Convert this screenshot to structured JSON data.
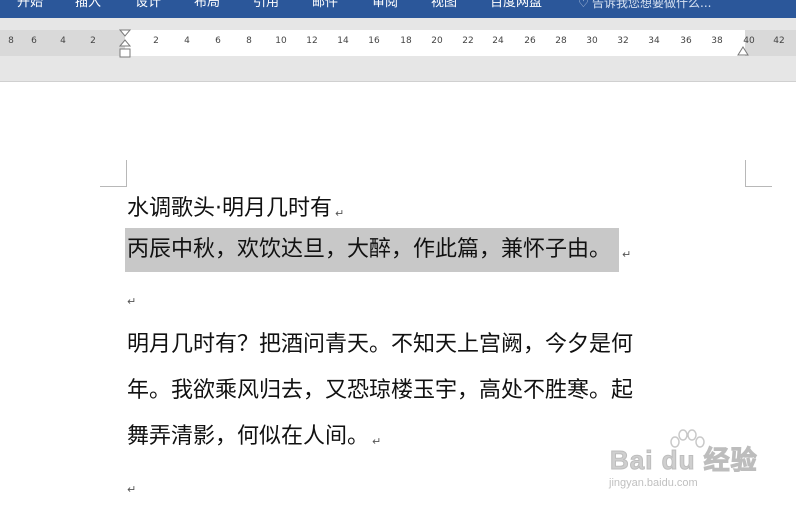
{
  "ribbon": {
    "tabs": [
      {
        "label": "开始"
      },
      {
        "label": "插入"
      },
      {
        "label": "设计"
      },
      {
        "label": "布局"
      },
      {
        "label": "引用"
      },
      {
        "label": "邮件"
      },
      {
        "label": "审阅"
      },
      {
        "label": "视图"
      },
      {
        "label": "百度网盘"
      }
    ],
    "tellme_text": "告诉我您想要做什么..."
  },
  "ruler": {
    "numbers": [
      "8",
      "6",
      "4",
      "2",
      "2",
      "4",
      "6",
      "8",
      "10",
      "12",
      "14",
      "16",
      "18",
      "20",
      "22",
      "24",
      "26",
      "28",
      "30",
      "32",
      "34",
      "36",
      "38",
      "40",
      "42"
    ]
  },
  "document": {
    "title": "水调歌头·明月几时有",
    "subtitle": "丙辰中秋，欢饮达旦，大醉，作此篇，兼怀子由。",
    "body_lines": [
      "明月几时有？把酒问青天。不知天上宫阙，今夕是何",
      "年。我欲乘风归去，又恐琼楼玉宇，高处不胜寒。起",
      "舞弄清影，何似在人间。"
    ],
    "paragraph_mark": "↵"
  },
  "watermark": {
    "logo": "Bai du 经验",
    "url": "jingyan.baidu.com"
  },
  "colors": {
    "ribbon": "#2b579a",
    "selection": "#c8c8c8"
  }
}
